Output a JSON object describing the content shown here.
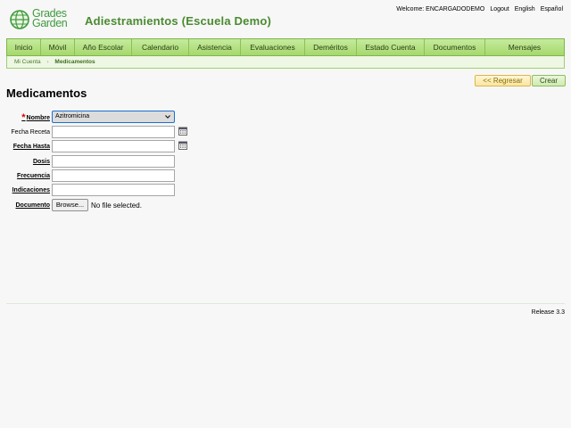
{
  "header": {
    "logo_line1": "Grades",
    "logo_line2": "Garden",
    "school_title": "Adiestramientos (Escuela Demo)",
    "welcome": "Welcome: ENCARGADODEMO",
    "logout": "Logout",
    "lang_en": "English",
    "lang_es": "Español"
  },
  "nav": {
    "items": [
      "Inicio",
      "Móvil",
      "Año Escolar",
      "Calendario",
      "Asistencia",
      "Evaluaciones",
      "Deméritos",
      "Estado Cuenta",
      "Documentos",
      "Mensajes"
    ]
  },
  "breadcrumb": {
    "parent": "Mi Cuenta",
    "separator": "›",
    "current": "Medicamentos"
  },
  "actions": {
    "back_label": "<< Regresar",
    "create_label": "Crear"
  },
  "page": {
    "title": "Medicamentos"
  },
  "form": {
    "required_mark": "*",
    "nombre": {
      "label": "Nombre",
      "value": "Azitromicina"
    },
    "fecha_receta": {
      "label": "Fecha Receta",
      "value": ""
    },
    "fecha_hasta": {
      "label": "Fecha Hasta",
      "value": ""
    },
    "dosis": {
      "label": "Dosis",
      "value": ""
    },
    "frecuencia": {
      "label": "Frecuencia",
      "value": ""
    },
    "indicaciones": {
      "label": "Indicaciones",
      "value": ""
    },
    "documento": {
      "label": "Documento",
      "browse_label": "Browse...",
      "status": "No file selected."
    }
  },
  "footer": {
    "release": "Release 3.3"
  },
  "icons": {
    "logo": "globe-icon",
    "calendar": "calendar-icon",
    "dropdown": "chevron-down-icon"
  },
  "colors": {
    "brand_green": "#4a8a30",
    "nav_green": "#a6d86c",
    "required": "#dd0000"
  }
}
